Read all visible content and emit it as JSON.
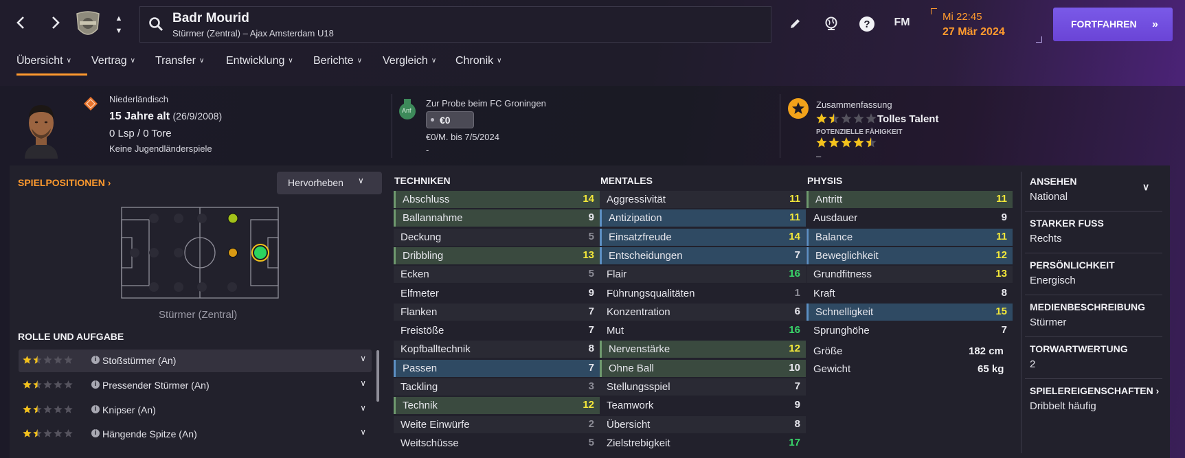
{
  "header": {
    "player_name": "Badr Mourid",
    "player_sub": "Stürmer (Zentral) – Ajax Amsterdam U18",
    "fm_label": "FM",
    "time": "Mi 22:45",
    "date": "27 Mär 2024",
    "continue_label": "FORTFAHREN"
  },
  "tabs": [
    {
      "label": "Übersicht"
    },
    {
      "label": "Vertrag"
    },
    {
      "label": "Transfer"
    },
    {
      "label": "Entwicklung"
    },
    {
      "label": "Berichte"
    },
    {
      "label": "Vergleich"
    },
    {
      "label": "Chronik"
    }
  ],
  "profile": {
    "nationality": "Niederländisch",
    "age": "15 Jahre alt",
    "dob": "(26/9/2008)",
    "caps": "0 Lsp / 0 Tore",
    "youth_caps": "Keine Jugendländerspiele"
  },
  "trial": {
    "badge": "Anf",
    "title": "Zur Probe beim FC Groningen",
    "amount": "€0",
    "terms": "€0/M. bis 7/5/2024",
    "dash": "-"
  },
  "summary": {
    "title": "Zusammenfassung",
    "talent": "Tolles Talent",
    "current_stars": 1.5,
    "potential_label": "POTENZIELLE FÄHIGKEIT",
    "potential_stars": 4.5,
    "dash": "–"
  },
  "positions": {
    "title": "SPIELPOSITIONEN",
    "highlight_label": "Hervorheben",
    "position_label": "Stürmer (Zentral)"
  },
  "roles": {
    "title": "ROLLE UND AUFGABE",
    "items": [
      {
        "name": "Stoßstürmer (An)",
        "stars": 1.5
      },
      {
        "name": "Pressender Stürmer (An)",
        "stars": 1.5
      },
      {
        "name": "Knipser (An)",
        "stars": 1.5
      },
      {
        "name": "Hängende Spitze (An)",
        "stars": 1.5
      }
    ]
  },
  "attributes": {
    "technical": {
      "title": "TECHNIKEN",
      "rows": [
        {
          "name": "Abschluss",
          "value": 14,
          "hl": "g"
        },
        {
          "name": "Ballannahme",
          "value": 9,
          "hl": "g"
        },
        {
          "name": "Deckung",
          "value": 5,
          "hl": ""
        },
        {
          "name": "Dribbling",
          "value": 13,
          "hl": "g"
        },
        {
          "name": "Ecken",
          "value": 5,
          "hl": ""
        },
        {
          "name": "Elfmeter",
          "value": 9,
          "hl": ""
        },
        {
          "name": "Flanken",
          "value": 7,
          "hl": ""
        },
        {
          "name": "Freistöße",
          "value": 7,
          "hl": ""
        },
        {
          "name": "Kopfballtechnik",
          "value": 8,
          "hl": ""
        },
        {
          "name": "Passen",
          "value": 7,
          "hl": "b"
        },
        {
          "name": "Tackling",
          "value": 3,
          "hl": ""
        },
        {
          "name": "Technik",
          "value": 12,
          "hl": "g"
        },
        {
          "name": "Weite Einwürfe",
          "value": 2,
          "hl": ""
        },
        {
          "name": "Weitschüsse",
          "value": 5,
          "hl": ""
        }
      ]
    },
    "mental": {
      "title": "MENTALES",
      "rows": [
        {
          "name": "Aggressivität",
          "value": 11,
          "hl": ""
        },
        {
          "name": "Antizipation",
          "value": 11,
          "hl": "b"
        },
        {
          "name": "Einsatzfreude",
          "value": 14,
          "hl": "b"
        },
        {
          "name": "Entscheidungen",
          "value": 7,
          "hl": "b"
        },
        {
          "name": "Flair",
          "value": 16,
          "hl": ""
        },
        {
          "name": "Führungsqualitäten",
          "value": 1,
          "hl": ""
        },
        {
          "name": "Konzentration",
          "value": 6,
          "hl": ""
        },
        {
          "name": "Mut",
          "value": 16,
          "hl": ""
        },
        {
          "name": "Nervenstärke",
          "value": 12,
          "hl": "g"
        },
        {
          "name": "Ohne Ball",
          "value": 10,
          "hl": "g"
        },
        {
          "name": "Stellungsspiel",
          "value": 7,
          "hl": ""
        },
        {
          "name": "Teamwork",
          "value": 9,
          "hl": ""
        },
        {
          "name": "Übersicht",
          "value": 8,
          "hl": ""
        },
        {
          "name": "Zielstrebigkeit",
          "value": 17,
          "hl": ""
        }
      ]
    },
    "physical": {
      "title": "PHYSIS",
      "rows": [
        {
          "name": "Antritt",
          "value": 11,
          "hl": "g"
        },
        {
          "name": "Ausdauer",
          "value": 9,
          "hl": ""
        },
        {
          "name": "Balance",
          "value": 11,
          "hl": "b"
        },
        {
          "name": "Beweglichkeit",
          "value": 12,
          "hl": "b"
        },
        {
          "name": "Grundfitness",
          "value": 13,
          "hl": ""
        },
        {
          "name": "Kraft",
          "value": 8,
          "hl": ""
        },
        {
          "name": "Schnelligkeit",
          "value": 15,
          "hl": "b"
        },
        {
          "name": "Sprunghöhe",
          "value": 7,
          "hl": ""
        }
      ],
      "height_label": "Größe",
      "height": "182 cm",
      "weight_label": "Gewicht",
      "weight": "65 kg"
    }
  },
  "info": [
    {
      "label": "ANSEHEN",
      "value": "National"
    },
    {
      "label": "STARKER FUSS",
      "value": "Rechts"
    },
    {
      "label": "PERSÖNLICHKEIT",
      "value": "Energisch"
    },
    {
      "label": "MEDIENBESCHREIBUNG",
      "value": "Stürmer"
    },
    {
      "label": "TORWARTWERTUNG",
      "value": "2"
    },
    {
      "label": "SPIELEREIGENSCHAFTEN",
      "value": "Dribbelt häufig"
    }
  ],
  "colors": {
    "accent": "#ff9a2e",
    "continue_button": "#6a44d6",
    "value_low": "#8c8c96",
    "value_mid": "#e8e8ee",
    "value_good": "#f3e83a",
    "value_high": "#39d56a"
  }
}
